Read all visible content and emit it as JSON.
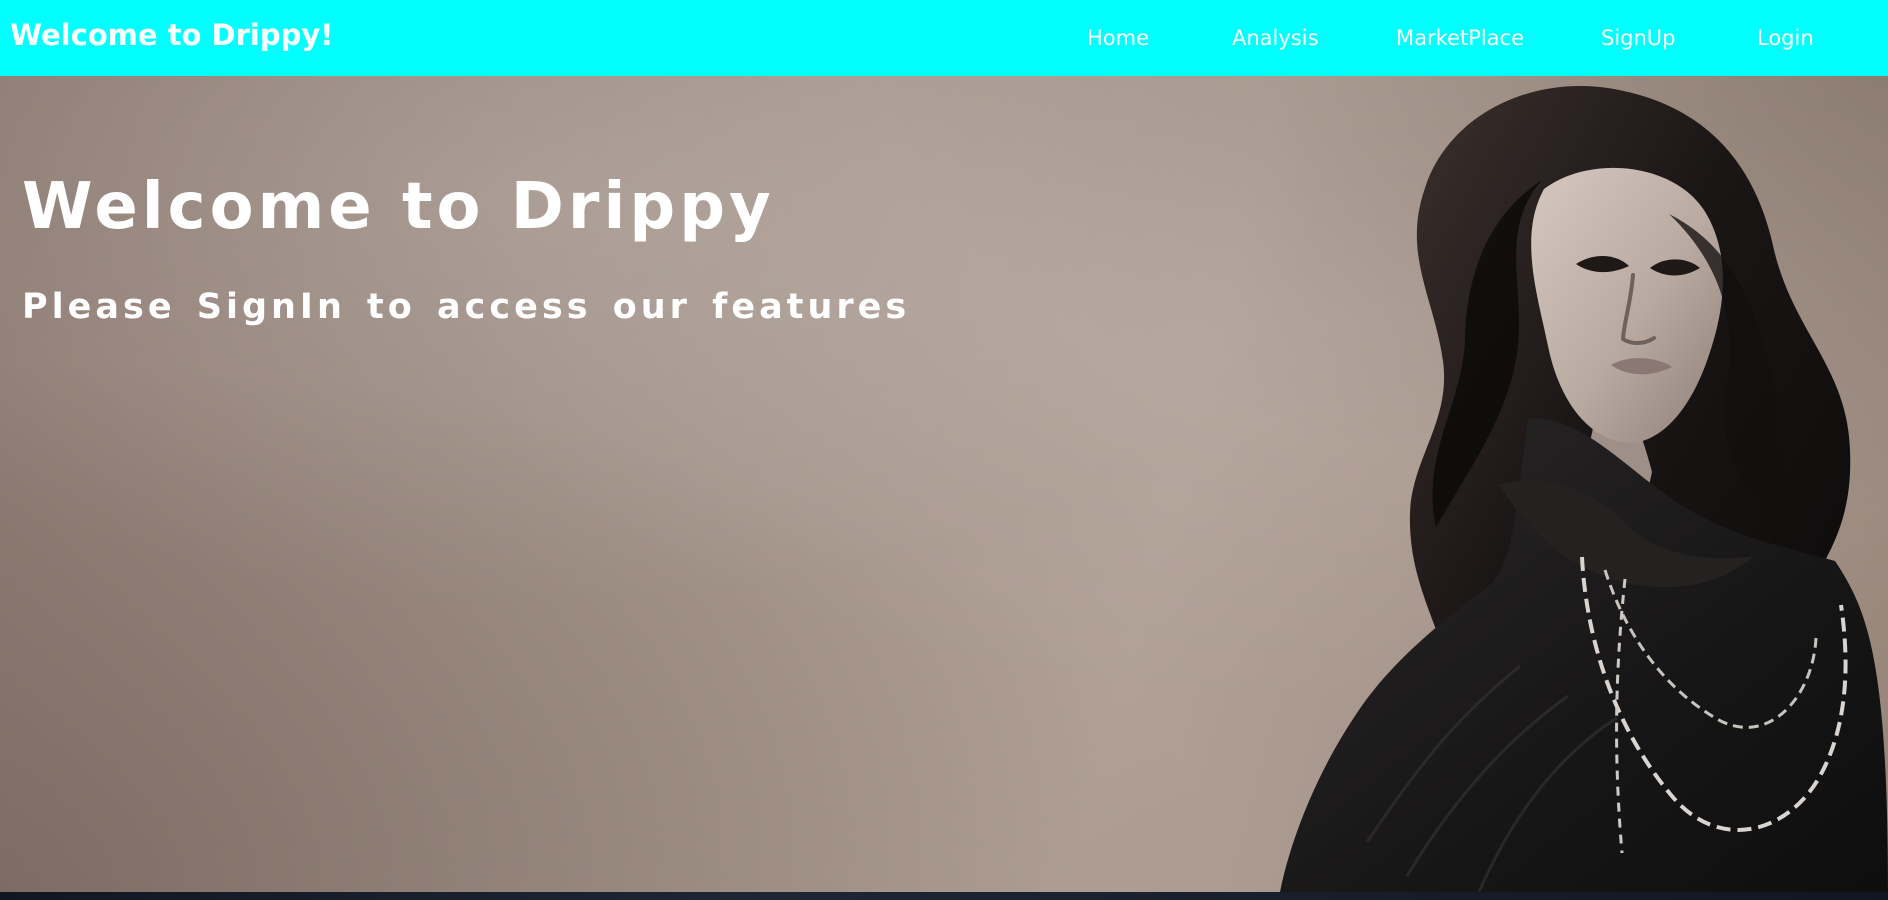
{
  "navbar": {
    "brand": "Welcome to Drippy!",
    "links": [
      {
        "label": "Home"
      },
      {
        "label": "Analysis"
      },
      {
        "label": "MarketPlace"
      },
      {
        "label": "SignUp"
      },
      {
        "label": "Login"
      }
    ]
  },
  "hero": {
    "title": "Welcome to Drippy",
    "subtitle": "Please SignIn to access our features"
  },
  "colors": {
    "navbar_background": "#00ffff",
    "navbar_text": "#ffffff",
    "hero_background": "#a09086",
    "hero_text": "#ffffff",
    "bottom_strip": "#151a22"
  }
}
